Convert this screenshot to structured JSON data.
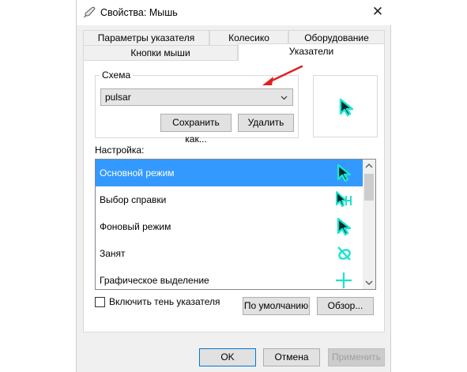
{
  "window": {
    "title": "Свойства: Мышь",
    "icon": "mouse-icon",
    "close_symbol": "✕"
  },
  "tabs_row1": [
    {
      "label": "Параметры указателя"
    },
    {
      "label": "Колесико"
    },
    {
      "label": "Оборудование"
    }
  ],
  "tabs_row2": [
    {
      "label": "Кнопки мыши"
    },
    {
      "label": "Указатели",
      "active": true
    }
  ],
  "scheme": {
    "legend": "Схема",
    "selected_value": "pulsar",
    "save_as_label": "Сохранить как...",
    "delete_label": "Удалить"
  },
  "customize": {
    "label": "Настройка:",
    "items": [
      {
        "label": "Основной режим",
        "selected": true,
        "icon": "arrow-cursor-icon"
      },
      {
        "label": "Выбор справки",
        "icon": "help-select-cursor-icon"
      },
      {
        "label": "Фоновый режим",
        "icon": "working-in-background-cursor-icon"
      },
      {
        "label": "Занят",
        "icon": "busy-cursor-icon"
      },
      {
        "label": "Графическое выделение",
        "icon": "precision-select-cursor-icon"
      }
    ]
  },
  "shadow_checkbox": {
    "label": "Включить тень указателя",
    "checked": false
  },
  "buttons": {
    "default_label": "По умолчанию",
    "browse_label": "Обзор...",
    "ok_label": "OK",
    "cancel_label": "Отмена",
    "apply_label": "Применить"
  },
  "colors": {
    "cursor_cyan": "#1ee3d0",
    "selection_blue": "#3399ff",
    "annotation_arrow": "#e02020"
  }
}
